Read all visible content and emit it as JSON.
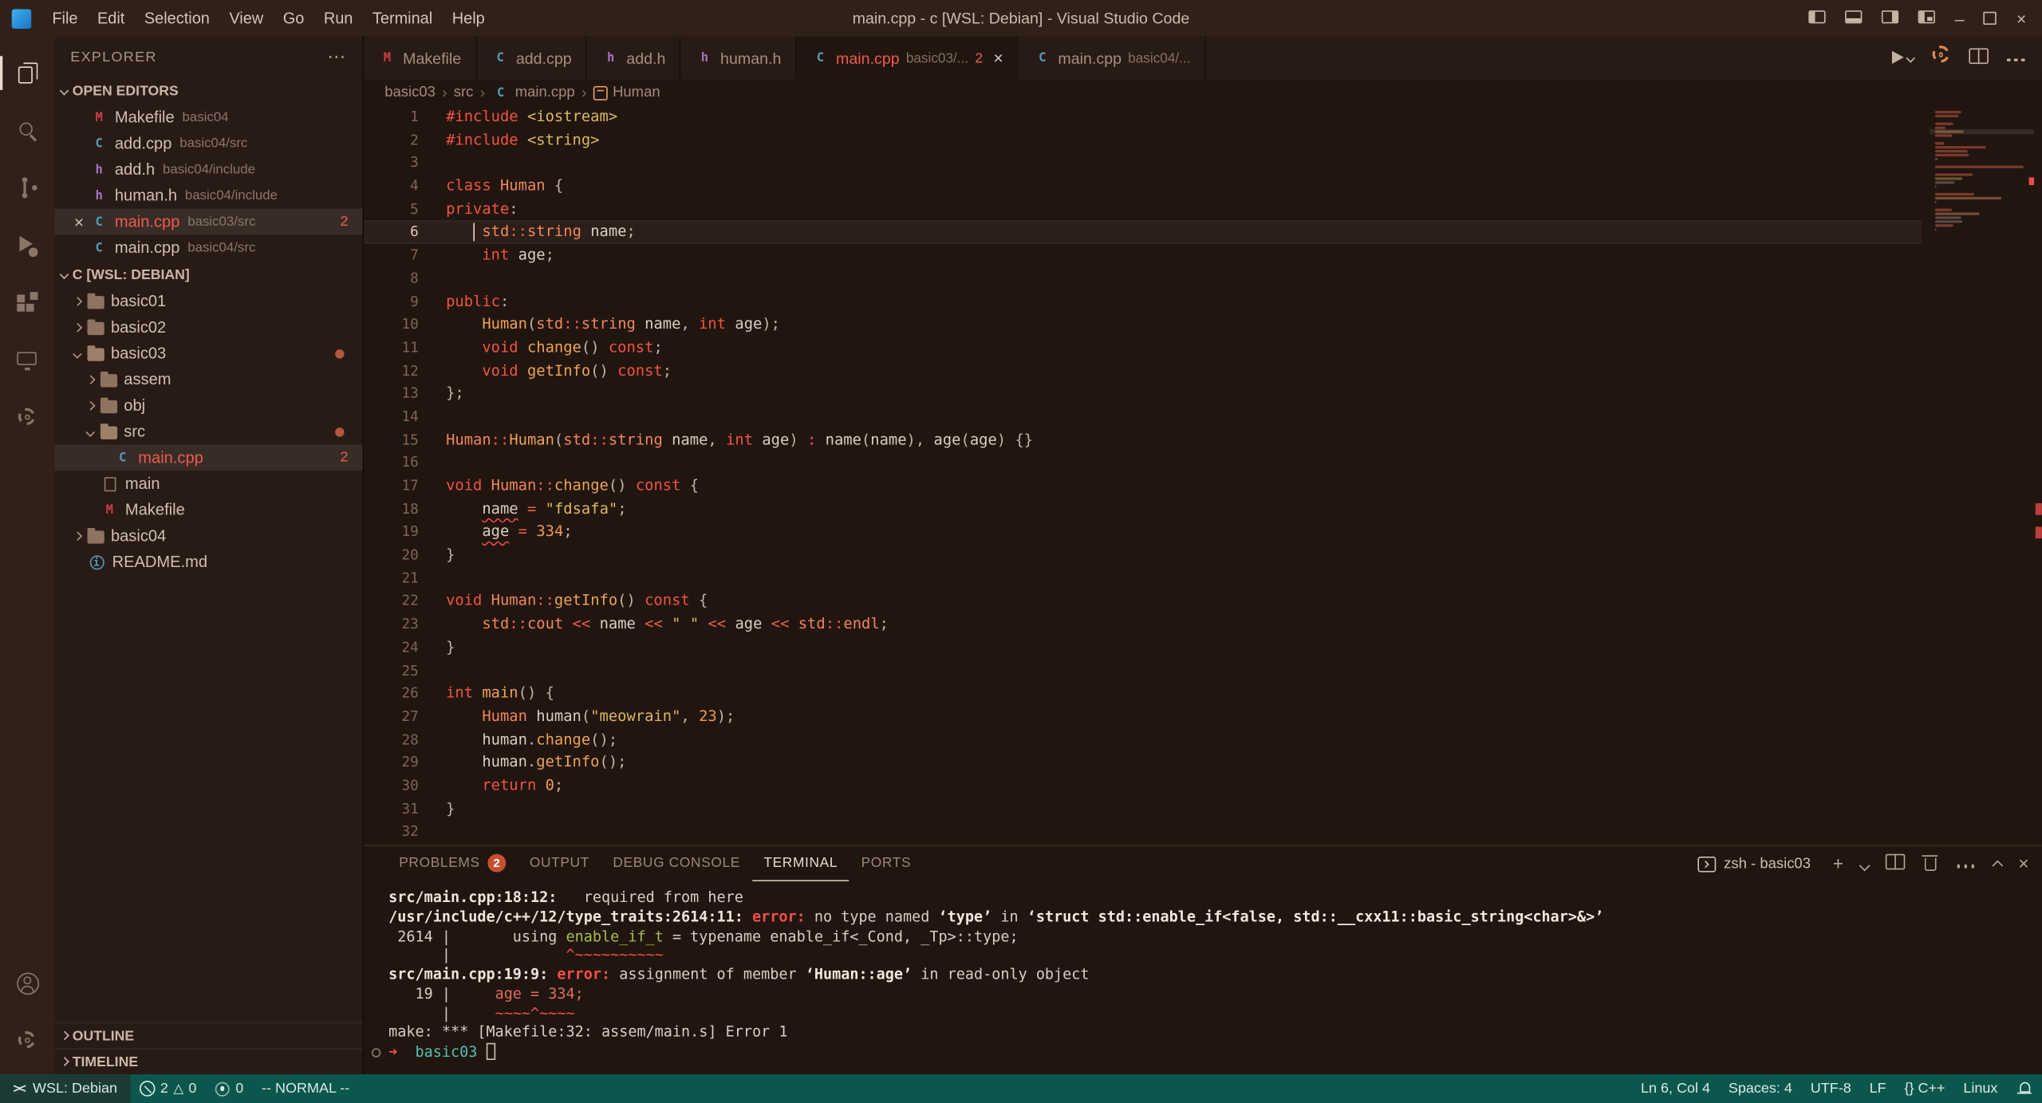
{
  "colors": {
    "status_bar": "#0c574d",
    "remote_chip": "#1c3b35",
    "error": "#f14c4c",
    "problems_badge": "#c7502f",
    "keyword_accent": "#f1553d",
    "cpp_icon": "#519aba",
    "header_icon": "#a074c4",
    "makefile_icon": "#cc3e44"
  },
  "title_bar": {
    "menus": [
      "File",
      "Edit",
      "Selection",
      "View",
      "Go",
      "Run",
      "Terminal",
      "Help"
    ],
    "title": "main.cpp - c [WSL: Debian] - Visual Studio Code",
    "window_controls": [
      "layout-sidebar-left",
      "layout-panel",
      "layout-sidebar-right",
      "layout-custom",
      "minimize",
      "maximize",
      "close"
    ]
  },
  "activity_bar": {
    "top": [
      {
        "name": "explorer",
        "icon": "explorer",
        "active": true
      },
      {
        "name": "search",
        "icon": "search"
      },
      {
        "name": "source-control",
        "icon": "scm"
      },
      {
        "name": "run-and-debug",
        "icon": "debug"
      },
      {
        "name": "extensions",
        "icon": "ext"
      },
      {
        "name": "remote-explorer",
        "icon": "monitor"
      },
      {
        "name": "tools",
        "icon": "gear"
      }
    ],
    "bottom": [
      {
        "name": "accounts",
        "icon": "account"
      },
      {
        "name": "manage",
        "icon": "gear"
      }
    ]
  },
  "sidebar": {
    "header": "EXPLORER",
    "open_editors_label": "OPEN EDITORS",
    "open_editors": [
      {
        "name": "Makefile",
        "path": "basic04",
        "icon": "makefile"
      },
      {
        "name": "add.cpp",
        "path": "basic04/src",
        "icon": "cpp"
      },
      {
        "name": "add.h",
        "path": "basic04/include",
        "icon": "h"
      },
      {
        "name": "human.h",
        "path": "basic04/include",
        "icon": "h"
      },
      {
        "name": "main.cpp",
        "path": "basic03/src",
        "icon": "cpp",
        "badge": "2",
        "error": true,
        "active": true
      },
      {
        "name": "main.cpp",
        "path": "basic04/src",
        "icon": "cpp"
      }
    ],
    "workspace_label": "C [WSL: DEBIAN]",
    "tree": [
      {
        "label": "basic01",
        "icon": "folder",
        "depth": 0,
        "twisty": "right"
      },
      {
        "label": "basic02",
        "icon": "folder",
        "depth": 0,
        "twisty": "right"
      },
      {
        "label": "basic03",
        "icon": "folder-open",
        "depth": 0,
        "twisty": "down",
        "dot": true
      },
      {
        "label": "assem",
        "icon": "folder",
        "depth": 1,
        "twisty": "right"
      },
      {
        "label": "obj",
        "icon": "folder",
        "depth": 1,
        "twisty": "right"
      },
      {
        "label": "src",
        "icon": "folder-open",
        "depth": 1,
        "twisty": "down",
        "dot": true
      },
      {
        "label": "main.cpp",
        "icon": "cpp",
        "depth": 2,
        "badge": "2",
        "error": true,
        "selected": true
      },
      {
        "label": "main",
        "icon": "file",
        "depth": 1
      },
      {
        "label": "Makefile",
        "icon": "makefile",
        "depth": 1
      },
      {
        "label": "basic04",
        "icon": "folder",
        "depth": 0,
        "twisty": "right"
      },
      {
        "label": "README.md",
        "icon": "readme",
        "depth": 0
      }
    ],
    "outline_label": "OUTLINE",
    "timeline_label": "TIMELINE"
  },
  "tabs": [
    {
      "icon": "makefile",
      "name": "Makefile"
    },
    {
      "icon": "cpp",
      "name": "add.cpp"
    },
    {
      "icon": "h",
      "name": "add.h"
    },
    {
      "icon": "h",
      "name": "human.h"
    },
    {
      "icon": "cpp",
      "name": "main.cpp",
      "dir": "basic03/...",
      "badge": "2",
      "active": true,
      "error": true,
      "close": true
    },
    {
      "icon": "cpp",
      "name": "main.cpp",
      "dir": "basic04/..."
    }
  ],
  "editor_actions": [
    {
      "name": "run-cpp-file",
      "icon": "play-dropdown"
    },
    {
      "name": "cpp-build-config",
      "icon": "gear-colored"
    },
    {
      "name": "split-editor",
      "icon": "split"
    },
    {
      "name": "editor-more-actions",
      "icon": "ellipsis"
    }
  ],
  "breadcrumb": [
    {
      "label": "basic03"
    },
    {
      "label": "src"
    },
    {
      "label": "main.cpp",
      "icon": "cpp"
    },
    {
      "label": "Human",
      "icon": "symbol-class"
    }
  ],
  "editor": {
    "current_line": 6,
    "cursor_line": 6,
    "cursor_col": 4,
    "error_lines": [
      18,
      19
    ],
    "lines": [
      [
        {
          "c": "kw",
          "t": "#include"
        },
        {
          "c": "pln",
          "t": " "
        },
        {
          "c": "str",
          "t": "<iostream>"
        }
      ],
      [
        {
          "c": "kw",
          "t": "#include"
        },
        {
          "c": "pln",
          "t": " "
        },
        {
          "c": "str",
          "t": "<string>"
        }
      ],
      [],
      [
        {
          "c": "kw",
          "t": "class "
        },
        {
          "c": "type",
          "t": "Human "
        },
        {
          "c": "pun",
          "t": "{"
        }
      ],
      [
        {
          "c": "kw",
          "t": "private"
        },
        {
          "c": "pun",
          "t": ":"
        }
      ],
      [
        {
          "c": "pln",
          "t": "    "
        },
        {
          "c": "type",
          "t": "std"
        },
        {
          "c": "op",
          "t": "::"
        },
        {
          "c": "type",
          "t": "string"
        },
        {
          "c": "pln",
          "t": " name"
        },
        {
          "c": "pun",
          "t": ";"
        }
      ],
      [
        {
          "c": "pln",
          "t": "    "
        },
        {
          "c": "kw",
          "t": "int"
        },
        {
          "c": "pln",
          "t": " age"
        },
        {
          "c": "pun",
          "t": ";"
        }
      ],
      [],
      [
        {
          "c": "kw",
          "t": "public"
        },
        {
          "c": "pun",
          "t": ":"
        }
      ],
      [
        {
          "c": "pln",
          "t": "    "
        },
        {
          "c": "fn",
          "t": "Human"
        },
        {
          "c": "pun",
          "t": "("
        },
        {
          "c": "type",
          "t": "std"
        },
        {
          "c": "op",
          "t": "::"
        },
        {
          "c": "type",
          "t": "string"
        },
        {
          "c": "pln",
          "t": " name"
        },
        {
          "c": "pun",
          "t": ", "
        },
        {
          "c": "kw",
          "t": "int"
        },
        {
          "c": "pln",
          "t": " age"
        },
        {
          "c": "pun",
          "t": ");"
        }
      ],
      [
        {
          "c": "pln",
          "t": "    "
        },
        {
          "c": "kw",
          "t": "void "
        },
        {
          "c": "fn",
          "t": "change"
        },
        {
          "c": "pun",
          "t": "() "
        },
        {
          "c": "kw",
          "t": "const"
        },
        {
          "c": "pun",
          "t": ";"
        }
      ],
      [
        {
          "c": "pln",
          "t": "    "
        },
        {
          "c": "kw",
          "t": "void "
        },
        {
          "c": "fn",
          "t": "getInfo"
        },
        {
          "c": "pun",
          "t": "() "
        },
        {
          "c": "kw",
          "t": "const"
        },
        {
          "c": "pun",
          "t": ";"
        }
      ],
      [
        {
          "c": "pun",
          "t": "};"
        }
      ],
      [],
      [
        {
          "c": "type",
          "t": "Human"
        },
        {
          "c": "op",
          "t": "::"
        },
        {
          "c": "fn",
          "t": "Human"
        },
        {
          "c": "pun",
          "t": "("
        },
        {
          "c": "type",
          "t": "std"
        },
        {
          "c": "op",
          "t": "::"
        },
        {
          "c": "type",
          "t": "string"
        },
        {
          "c": "pln",
          "t": " name"
        },
        {
          "c": "pun",
          "t": ", "
        },
        {
          "c": "kw",
          "t": "int"
        },
        {
          "c": "pln",
          "t": " age"
        },
        {
          "c": "pun",
          "t": ") "
        },
        {
          "c": "op",
          "t": ": "
        },
        {
          "c": "pln",
          "t": "name"
        },
        {
          "c": "pun",
          "t": "("
        },
        {
          "c": "pln",
          "t": "name"
        },
        {
          "c": "pun",
          "t": "), "
        },
        {
          "c": "pln",
          "t": "age"
        },
        {
          "c": "pun",
          "t": "("
        },
        {
          "c": "pln",
          "t": "age"
        },
        {
          "c": "pun",
          "t": ") "
        },
        {
          "c": "pun",
          "t": "{}"
        }
      ],
      [],
      [
        {
          "c": "kw",
          "t": "void "
        },
        {
          "c": "type",
          "t": "Human"
        },
        {
          "c": "op",
          "t": "::"
        },
        {
          "c": "fn",
          "t": "change"
        },
        {
          "c": "pun",
          "t": "() "
        },
        {
          "c": "kw",
          "t": "const "
        },
        {
          "c": "pun",
          "t": "{"
        }
      ],
      [
        {
          "c": "pln",
          "t": "    "
        },
        {
          "c": "pln err",
          "t": "name"
        },
        {
          "c": "pln",
          "t": " "
        },
        {
          "c": "op",
          "t": "="
        },
        {
          "c": "pln",
          "t": " "
        },
        {
          "c": "str",
          "t": "\"fdsafa\""
        },
        {
          "c": "pun",
          "t": ";"
        }
      ],
      [
        {
          "c": "pln",
          "t": "    "
        },
        {
          "c": "pln err",
          "t": "age"
        },
        {
          "c": "pln",
          "t": " "
        },
        {
          "c": "op",
          "t": "="
        },
        {
          "c": "pln",
          "t": " "
        },
        {
          "c": "num",
          "t": "334"
        },
        {
          "c": "pun",
          "t": ";"
        }
      ],
      [
        {
          "c": "pun",
          "t": "}"
        }
      ],
      [],
      [
        {
          "c": "kw",
          "t": "void "
        },
        {
          "c": "type",
          "t": "Human"
        },
        {
          "c": "op",
          "t": "::"
        },
        {
          "c": "fn",
          "t": "getInfo"
        },
        {
          "c": "pun",
          "t": "() "
        },
        {
          "c": "kw",
          "t": "const "
        },
        {
          "c": "pun",
          "t": "{"
        }
      ],
      [
        {
          "c": "pln",
          "t": "    "
        },
        {
          "c": "type",
          "t": "std"
        },
        {
          "c": "op",
          "t": "::"
        },
        {
          "c": "type",
          "t": "cout"
        },
        {
          "c": "pln",
          "t": " "
        },
        {
          "c": "op",
          "t": "<<"
        },
        {
          "c": "pln",
          "t": " name "
        },
        {
          "c": "op",
          "t": "<<"
        },
        {
          "c": "pln",
          "t": " "
        },
        {
          "c": "str",
          "t": "\" \""
        },
        {
          "c": "pln",
          "t": " "
        },
        {
          "c": "op",
          "t": "<<"
        },
        {
          "c": "pln",
          "t": " age "
        },
        {
          "c": "op",
          "t": "<<"
        },
        {
          "c": "pln",
          "t": " "
        },
        {
          "c": "type",
          "t": "std"
        },
        {
          "c": "op",
          "t": "::"
        },
        {
          "c": "type",
          "t": "endl"
        },
        {
          "c": "pun",
          "t": ";"
        }
      ],
      [
        {
          "c": "pun",
          "t": "}"
        }
      ],
      [],
      [
        {
          "c": "kw",
          "t": "int "
        },
        {
          "c": "fn",
          "t": "main"
        },
        {
          "c": "pun",
          "t": "() {"
        }
      ],
      [
        {
          "c": "pln",
          "t": "    "
        },
        {
          "c": "type",
          "t": "Human"
        },
        {
          "c": "pln",
          "t": " human"
        },
        {
          "c": "pun",
          "t": "("
        },
        {
          "c": "str",
          "t": "\"meowrain\""
        },
        {
          "c": "pun",
          "t": ", "
        },
        {
          "c": "num",
          "t": "23"
        },
        {
          "c": "pun",
          "t": ");"
        }
      ],
      [
        {
          "c": "pln",
          "t": "    human"
        },
        {
          "c": "pun",
          "t": "."
        },
        {
          "c": "fn",
          "t": "change"
        },
        {
          "c": "pun",
          "t": "();"
        }
      ],
      [
        {
          "c": "pln",
          "t": "    human"
        },
        {
          "c": "pun",
          "t": "."
        },
        {
          "c": "fn",
          "t": "getInfo"
        },
        {
          "c": "pun",
          "t": "();"
        }
      ],
      [
        {
          "c": "pln",
          "t": "    "
        },
        {
          "c": "kw",
          "t": "return "
        },
        {
          "c": "num",
          "t": "0"
        },
        {
          "c": "pun",
          "t": ";"
        }
      ],
      [
        {
          "c": "pun",
          "t": "}"
        }
      ],
      []
    ]
  },
  "panel": {
    "tabs": [
      {
        "label": "PROBLEMS",
        "badge": "2"
      },
      {
        "label": "OUTPUT"
      },
      {
        "label": "DEBUG CONSOLE"
      },
      {
        "label": "TERMINAL",
        "active": true
      },
      {
        "label": "PORTS"
      }
    ],
    "terminal_select": "zsh - basic03",
    "actions": [
      {
        "name": "new-terminal",
        "icon": "plus"
      },
      {
        "name": "terminal-picker",
        "icon": "chev-down"
      },
      {
        "name": "split-terminal",
        "icon": "split"
      },
      {
        "name": "kill-terminal",
        "icon": "trash"
      },
      {
        "name": "terminal-more-actions",
        "icon": "ellipsis"
      },
      {
        "name": "maximize-panel",
        "icon": "chev-up"
      },
      {
        "name": "close-panel",
        "icon": "close"
      }
    ],
    "decorated_line": 8,
    "terminal_lines": [
      [
        {
          "c": "path",
          "t": "src/main.cpp:18:12:"
        },
        {
          "c": "pln",
          "t": "   required from here"
        }
      ],
      [
        {
          "c": "path",
          "t": "/usr/include/c++/12/type_traits:2614:11:"
        },
        {
          "c": "pln",
          "t": " "
        },
        {
          "c": "error",
          "t": "error: "
        },
        {
          "c": "pln",
          "t": "no type named "
        },
        {
          "c": "em",
          "t": "‘type’"
        },
        {
          "c": "pln",
          "t": " in "
        },
        {
          "c": "em",
          "t": "‘struct std::enable_if<false, std::__cxx11::basic_string<char>&>’"
        }
      ],
      [
        {
          "c": "pln",
          "t": " 2614 |       using "
        },
        {
          "c": "green",
          "t": "enable_if_t"
        },
        {
          "c": "pln",
          "t": " = typename enable_if<_Cond, _Tp>::type;"
        }
      ],
      [
        {
          "c": "pln",
          "t": "      |             "
        },
        {
          "c": "caret",
          "t": "^~~~~~~~~~~"
        }
      ],
      [
        {
          "c": "path",
          "t": "src/main.cpp:19:9:"
        },
        {
          "c": "pln",
          "t": " "
        },
        {
          "c": "error",
          "t": "error: "
        },
        {
          "c": "pln",
          "t": "assignment of member "
        },
        {
          "c": "em",
          "t": "‘Human::age’"
        },
        {
          "c": "pln",
          "t": " in read-only object"
        }
      ],
      [
        {
          "c": "pln",
          "t": "   19 |     "
        },
        {
          "c": "range",
          "t": "age = 334;"
        }
      ],
      [
        {
          "c": "pln",
          "t": "      |     "
        },
        {
          "c": "caret",
          "t": "~~~~^~~~~"
        }
      ],
      [
        {
          "c": "pln",
          "t": "make: *** [Makefile:32: assem/main.s] Error 1"
        }
      ],
      [
        {
          "c": "arrow",
          "t": "➜"
        },
        {
          "c": "pln",
          "t": "  "
        },
        {
          "c": "dir",
          "t": "basic03"
        },
        {
          "c": "pln",
          "t": " "
        },
        {
          "c": "cursor",
          "t": " "
        }
      ]
    ]
  },
  "status_bar": {
    "remote": "WSL: Debian",
    "errors": "2",
    "warnings": "0",
    "ports": "0",
    "mode": "-- NORMAL --",
    "right": [
      {
        "name": "cursor-position",
        "text": "Ln 6, Col 4"
      },
      {
        "name": "indentation",
        "text": "Spaces: 4"
      },
      {
        "name": "encoding",
        "text": "UTF-8"
      },
      {
        "name": "eol",
        "text": "LF"
      },
      {
        "name": "language-mode",
        "text": "{} C++"
      },
      {
        "name": "remote-os",
        "text": "Linux"
      }
    ]
  }
}
